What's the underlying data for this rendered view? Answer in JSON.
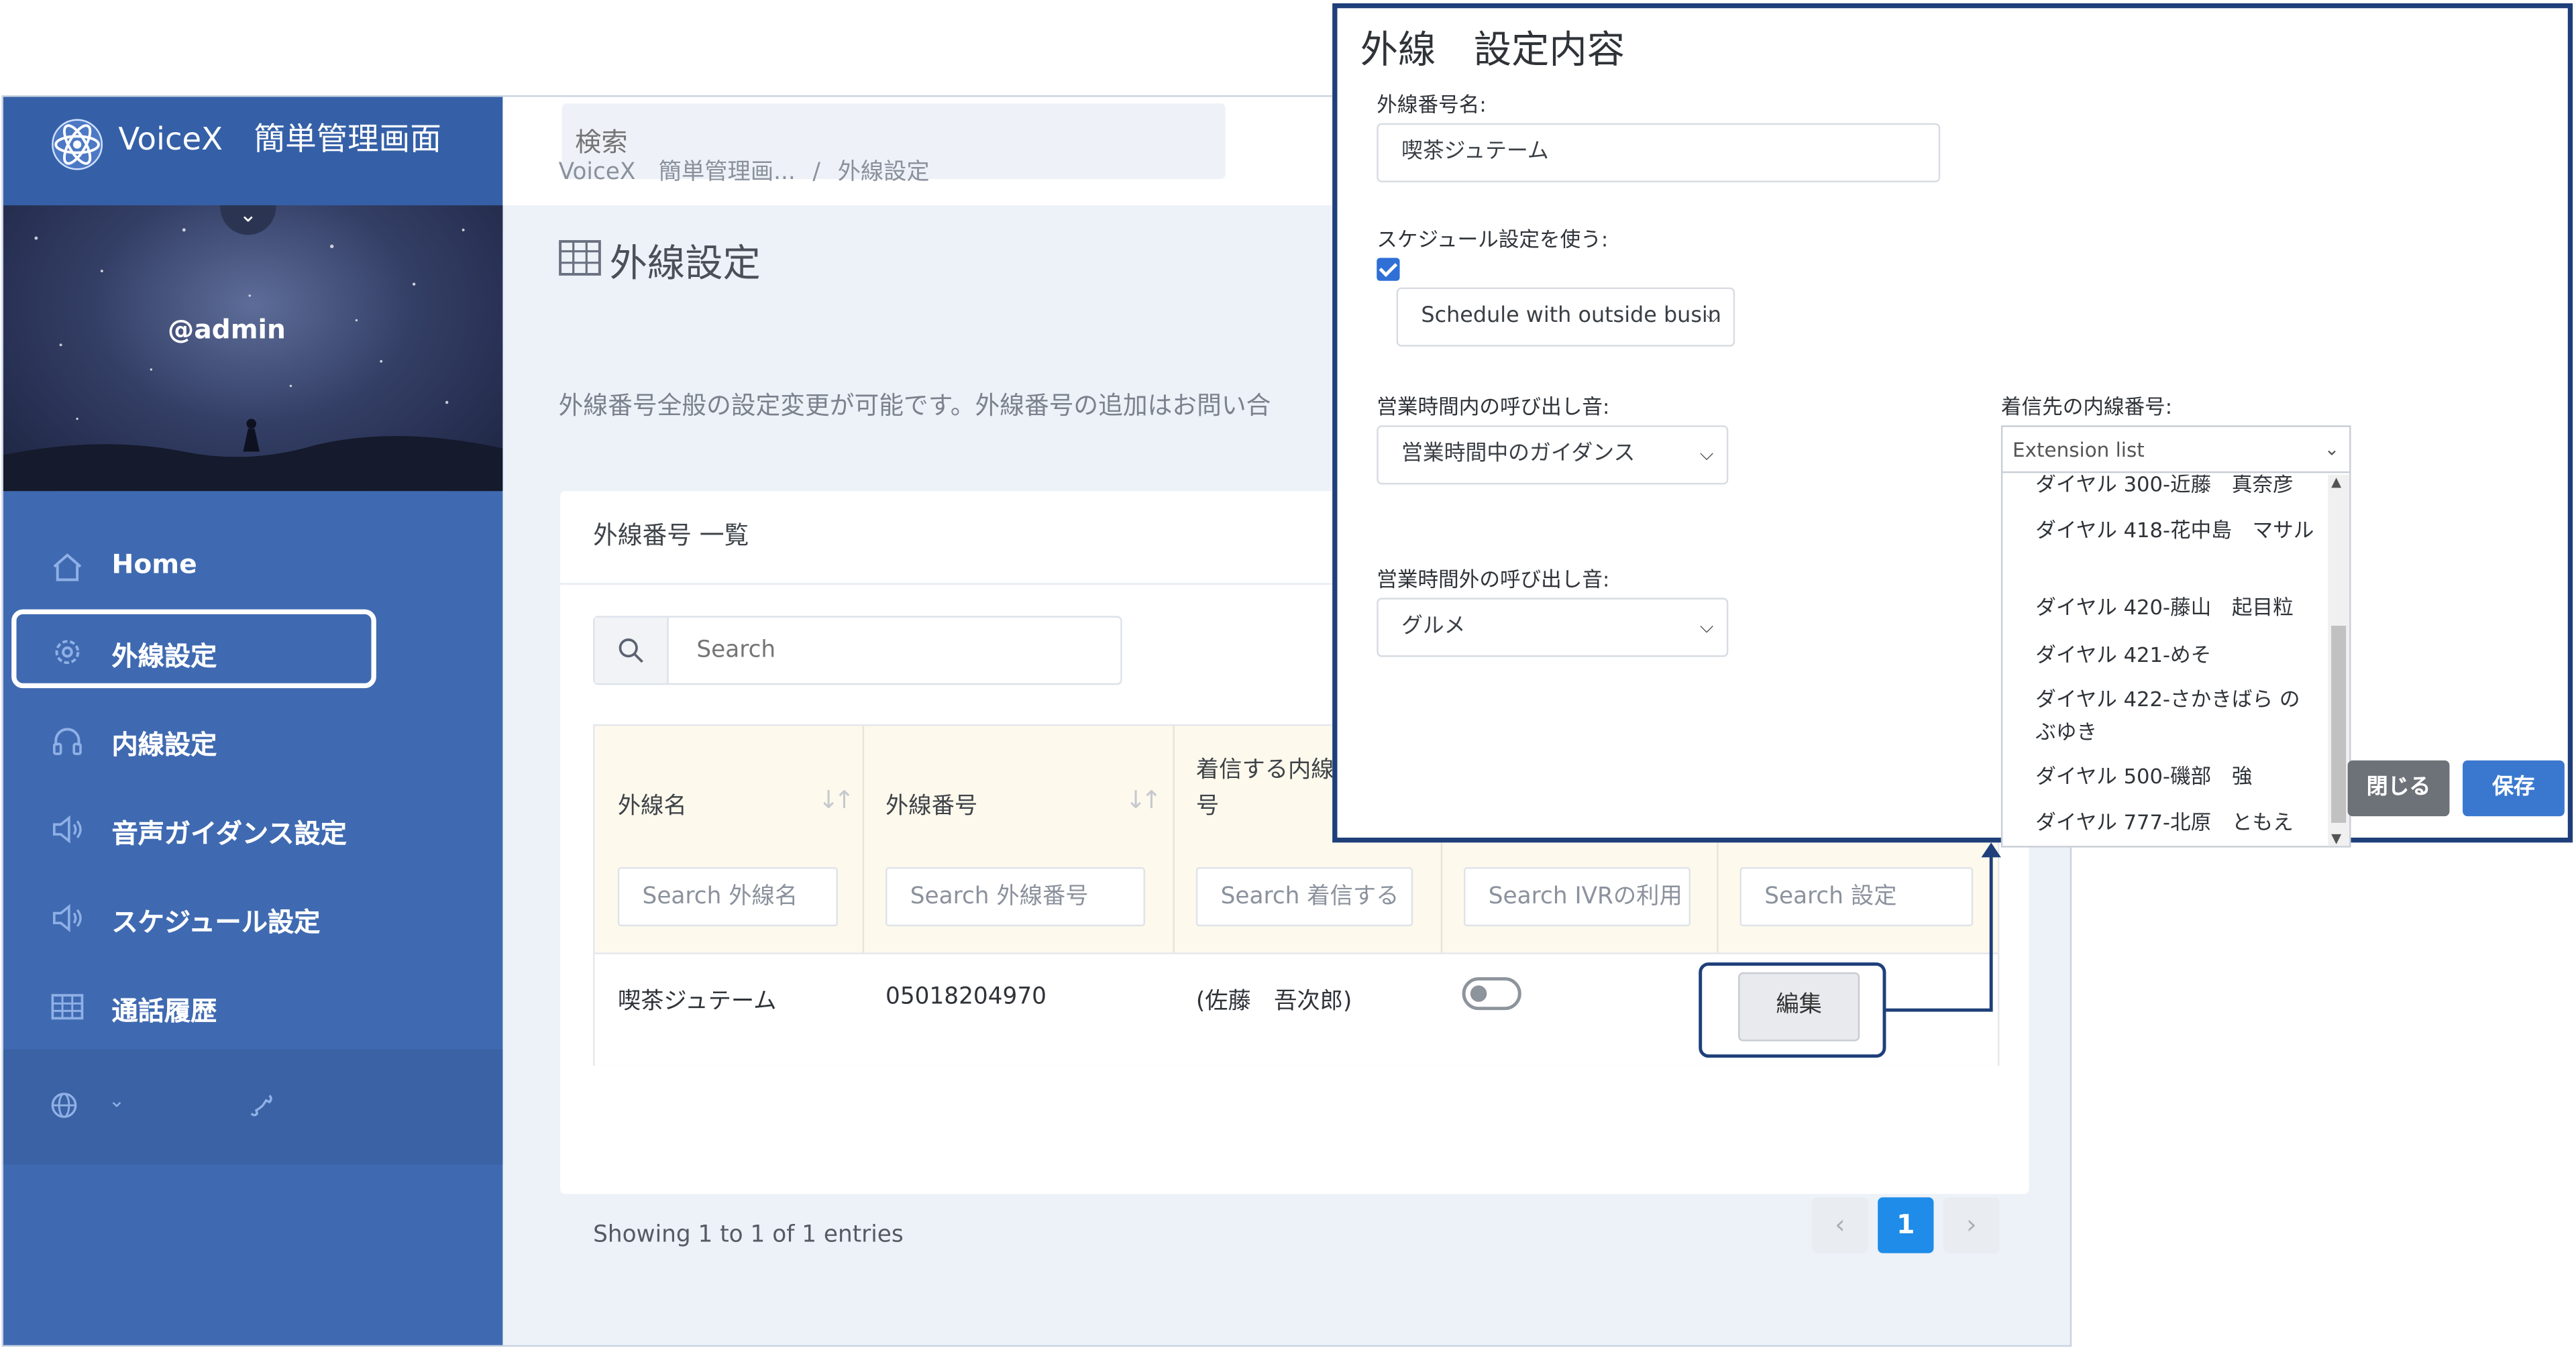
{
  "brand": {
    "name": "VoiceX　簡単管理画面"
  },
  "user": {
    "name": "@admin"
  },
  "sidebar": {
    "items": [
      {
        "label": "Home",
        "icon": "home-icon"
      },
      {
        "label": "外線設定",
        "icon": "gear-icon",
        "active": true
      },
      {
        "label": "内線設定",
        "icon": "headset-icon"
      },
      {
        "label": "音声ガイダンス設定",
        "icon": "speaker-icon"
      },
      {
        "label": "スケジュール設定",
        "icon": "speaker-icon"
      },
      {
        "label": "通話履歴",
        "icon": "table-icon"
      }
    ],
    "footer_icons": [
      "globe-icon",
      "chevron-down-icon",
      "phone-icon"
    ]
  },
  "topbar": {
    "search_placeholder": "検索"
  },
  "breadcrumb": {
    "items": [
      "VoiceX　簡単管理画...",
      "外線設定"
    ],
    "separator": "/"
  },
  "page": {
    "title": "外線設定",
    "subtitle": "外線番号全般の設定変更が可能です。外線番号の追加はお問い合"
  },
  "card": {
    "title": "外線番号 一覧",
    "search_placeholder": "Search",
    "columns": [
      {
        "label": "外線名",
        "filter": "Search 外線名"
      },
      {
        "label": "外線番号",
        "filter": "Search 外線番号"
      },
      {
        "label": "着信する内線番号",
        "label_line1": "着信する内線",
        "label_line2": "号",
        "filter": "Search 着信する"
      },
      {
        "label": "",
        "filter": "Search IVRの利用"
      },
      {
        "label": "",
        "filter": "Search 設定"
      }
    ],
    "rows": [
      {
        "name": "喫茶ジュテーム",
        "number": "05018204970",
        "extension": "(佐藤　吾次郎)",
        "ivr": false,
        "action": "編集"
      }
    ],
    "showing": "Showing 1 to 1 of 1 entries",
    "pagination": {
      "prev": "‹",
      "current": "1",
      "next": "›"
    }
  },
  "modal": {
    "title": "外線　設定内容",
    "line_name_label": "外線番号名:",
    "line_name_value": "喫茶ジュテーム",
    "schedule_label": "スケジュール設定を使う:",
    "schedule_checked": true,
    "schedule_value": "Schedule with outside busin",
    "business_hours_label": "営業時間内の呼び出し音:",
    "business_hours_value": "営業時間中のガイダンス",
    "after_hours_label": "営業時間外の呼び出し音:",
    "after_hours_value": "グルメ",
    "extension_label": "着信先の内線番号:",
    "extension_placeholder": "Extension list",
    "extensions": [
      "ダイヤル 300-近藤　真奈彦",
      "ダイヤル 418-花中島　マサル",
      "ダイヤル 420-藤山　起目粒",
      "ダイヤル 421-めそ",
      "ダイヤル 422-さかきばら のぶゆき",
      "ダイヤル 500-磯部　強",
      "ダイヤル 777-北原　ともえ"
    ],
    "close_label": "閉じる",
    "save_label": "保存"
  },
  "colors": {
    "sidebar": "#3f6ab1",
    "accent": "#2f7fd8",
    "callout": "#1e3f7a",
    "table_header": "#fdf9ec",
    "save_button": "#3a78cf",
    "close_button": "#6d7278"
  }
}
